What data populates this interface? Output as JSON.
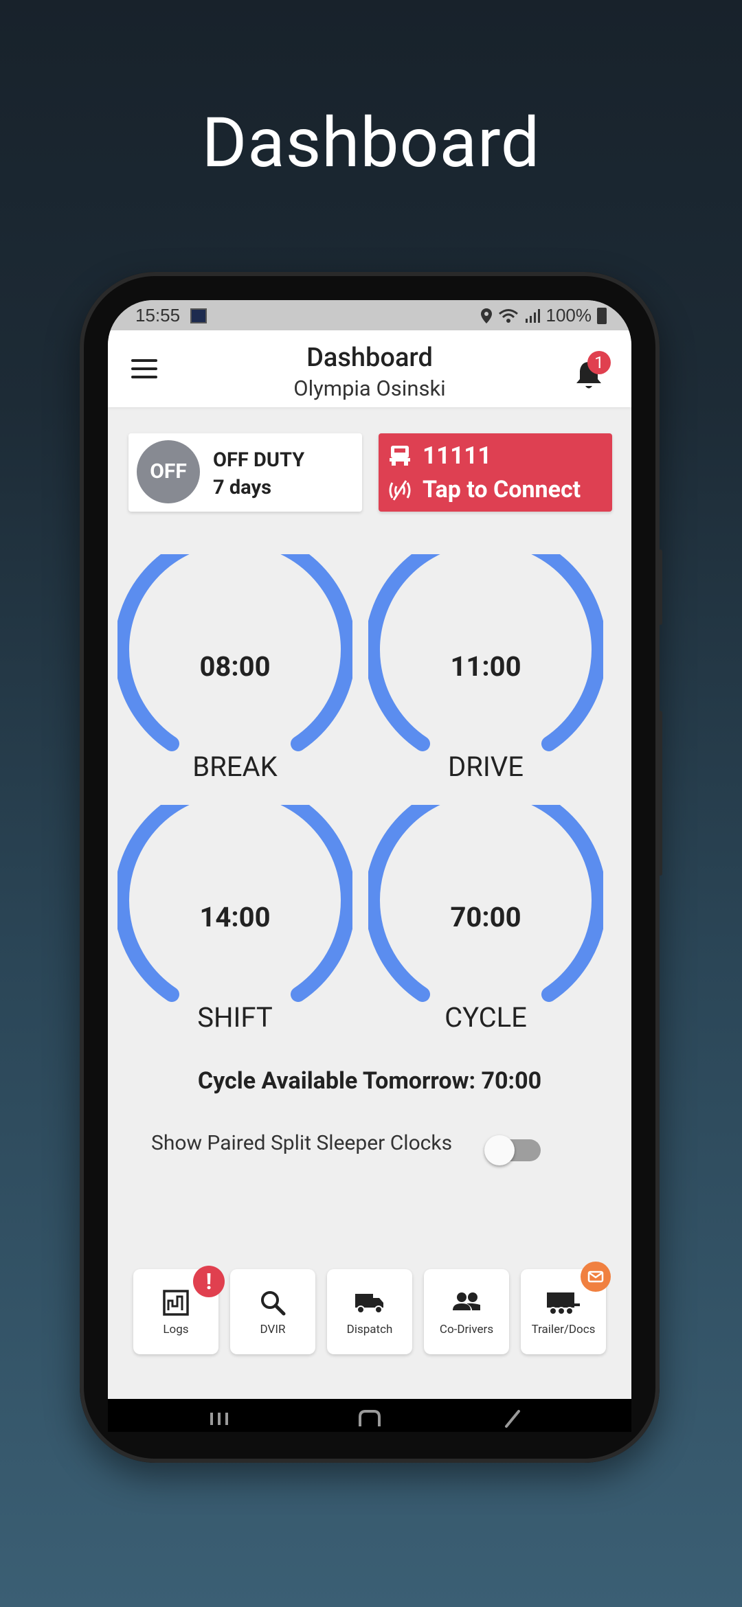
{
  "promo": {
    "title": "Dashboard"
  },
  "status_bar": {
    "time": "15:55",
    "battery": "100%"
  },
  "header": {
    "title": "Dashboard",
    "subtitle": "Olympia Osinski",
    "notification_count": "1",
    "menu_icon": "hamburger-menu-icon",
    "bell_icon": "bell-icon"
  },
  "duty": {
    "badge": "OFF",
    "status": "OFF DUTY",
    "duration": "7 days"
  },
  "vehicle": {
    "id": "11111",
    "action": "Tap to Connect",
    "color": "#de4052"
  },
  "gauges": [
    {
      "value": "08:00",
      "label": "BREAK"
    },
    {
      "value": "11:00",
      "label": "DRIVE"
    },
    {
      "value": "14:00",
      "label": "SHIFT"
    },
    {
      "value": "70:00",
      "label": "CYCLE"
    }
  ],
  "gauge_color": "#5b8def",
  "cycle_tomorrow": "Cycle Available Tomorrow: 70:00",
  "split_sleeper": {
    "label": "Show Paired Split Sleeper Clocks",
    "enabled": false
  },
  "bottom_nav": [
    {
      "label": "Logs",
      "icon": "logs-chart-icon",
      "badge": "!"
    },
    {
      "label": "DVIR",
      "icon": "search-icon"
    },
    {
      "label": "Dispatch",
      "icon": "truck-icon"
    },
    {
      "label": "Co-Drivers",
      "icon": "people-icon"
    },
    {
      "label": "Trailer/Docs",
      "icon": "trailer-icon",
      "badge": "mail-icon"
    }
  ]
}
